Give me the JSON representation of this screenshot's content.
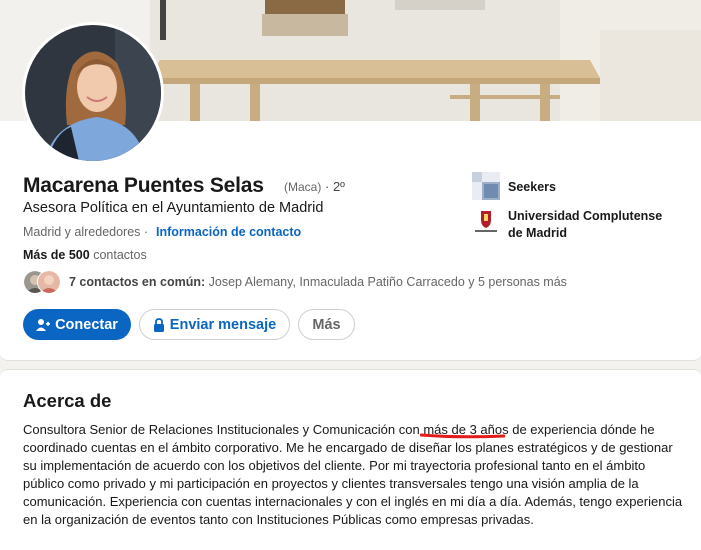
{
  "profile": {
    "name": "Macarena Puentes Selas",
    "nickname": "(Maca)",
    "degree": "· 2º",
    "headline": "Asesora Política en el Ayuntamiento de Madrid",
    "location": "Madrid y alrededores ·",
    "contact_info": "Información de contacto",
    "connections_bold": "Más de 500",
    "connections_rest": " contactos",
    "mutual_bold": "7 contactos en común:",
    "mutual_rest": " Josep Alemany, Inmaculada Patiño Carracedo y 5 personas más"
  },
  "actions": {
    "connect": "Conectar",
    "message": "Enviar mensaje",
    "more": "Más"
  },
  "orgs": [
    {
      "line1": "Seekers",
      "line2": ""
    },
    {
      "line1": "Universidad Complutense",
      "line2": "de Madrid"
    }
  ],
  "about": {
    "title": "Acerca de",
    "part1": "Consultora Senior de Relaciones Institucionales y Comunicación con ",
    "highlight": "más de 3 años",
    "part2": " de experiencia dónde he coordinado cuentas en el ámbito corporativo. Me he encargado de diseñar los planes estratégicos y de gestionar su implementación de acuerdo con los objetivos del cliente. Por mi trayectoria profesional tanto en el ámbito público como privado y mi participación en proyectos y clientes transversales tengo una visión amplia de la comunicación. Experiencia con cuentas internacionales y con el inglés en mi día a día. Además, tengo experiencia en la organización de eventos tanto con Instituciones Públicas como empresas privadas."
  },
  "colors": {
    "accent": "#0a66c2",
    "highlight_mark": "#e31b1b"
  }
}
